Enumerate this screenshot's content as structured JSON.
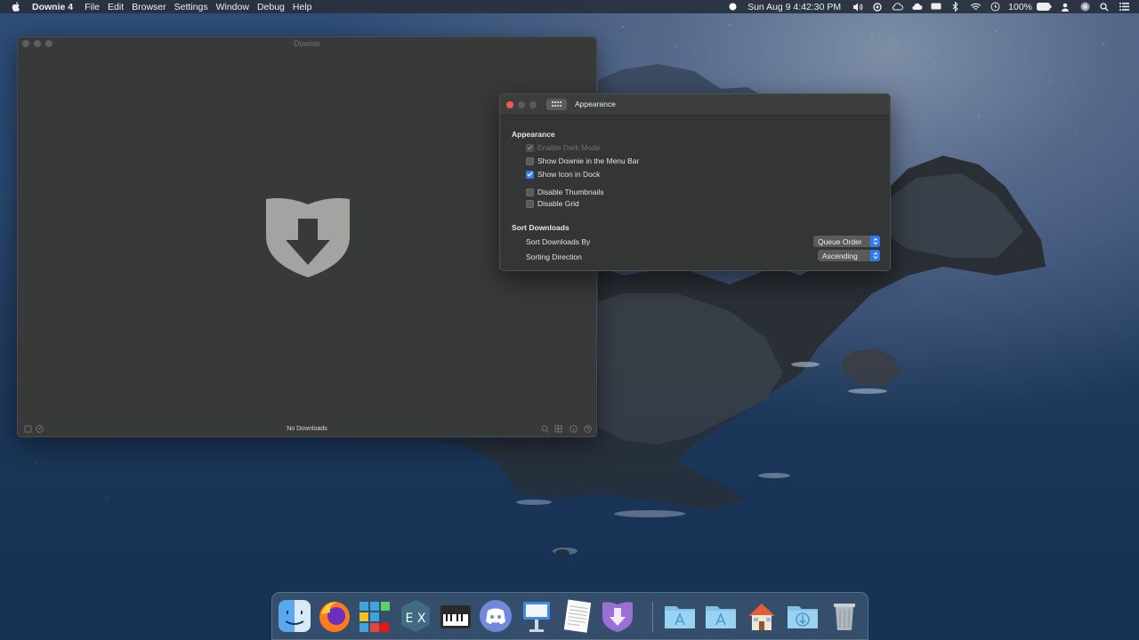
{
  "menubar": {
    "app_name": "Downie 4",
    "menus": [
      "File",
      "Edit",
      "Browser",
      "Settings",
      "Window",
      "Debug",
      "Help"
    ],
    "clock": "Sun Aug 9  4:42:30 PM",
    "battery": "100%"
  },
  "main_window": {
    "title": "Downie",
    "status": "No Downloads"
  },
  "prefs_window": {
    "title": "Appearance",
    "appearance_section": "Appearance",
    "options": {
      "dark_mode": {
        "label": "Enable Dark Mode",
        "checked": true,
        "enabled": false
      },
      "menu_bar": {
        "label": "Show Downie in the Menu Bar",
        "checked": false
      },
      "dock_icon": {
        "label": "Show Icon in Dock",
        "checked": true
      },
      "thumbnails": {
        "label": "Disable Thumbnails",
        "checked": false
      },
      "grid": {
        "label": "Disable Grid",
        "checked": false
      }
    },
    "sort_section": "Sort Downloads",
    "sort_by_label": "Sort Downloads By",
    "sort_by_value": "Queue Order",
    "direction_label": "Sorting Direction",
    "direction_value": "Ascending"
  },
  "dock": {
    "items": [
      "finder-icon",
      "firefox-icon",
      "grid-app-icon",
      "exchange-app-icon",
      "piano-app-icon",
      "discord-icon",
      "keynote-icon",
      "textedit-icon",
      "downie-icon",
      "applications-folder-icon",
      "applications-folder-icon",
      "home-folder-icon",
      "downloads-folder-icon",
      "trash-icon"
    ]
  }
}
